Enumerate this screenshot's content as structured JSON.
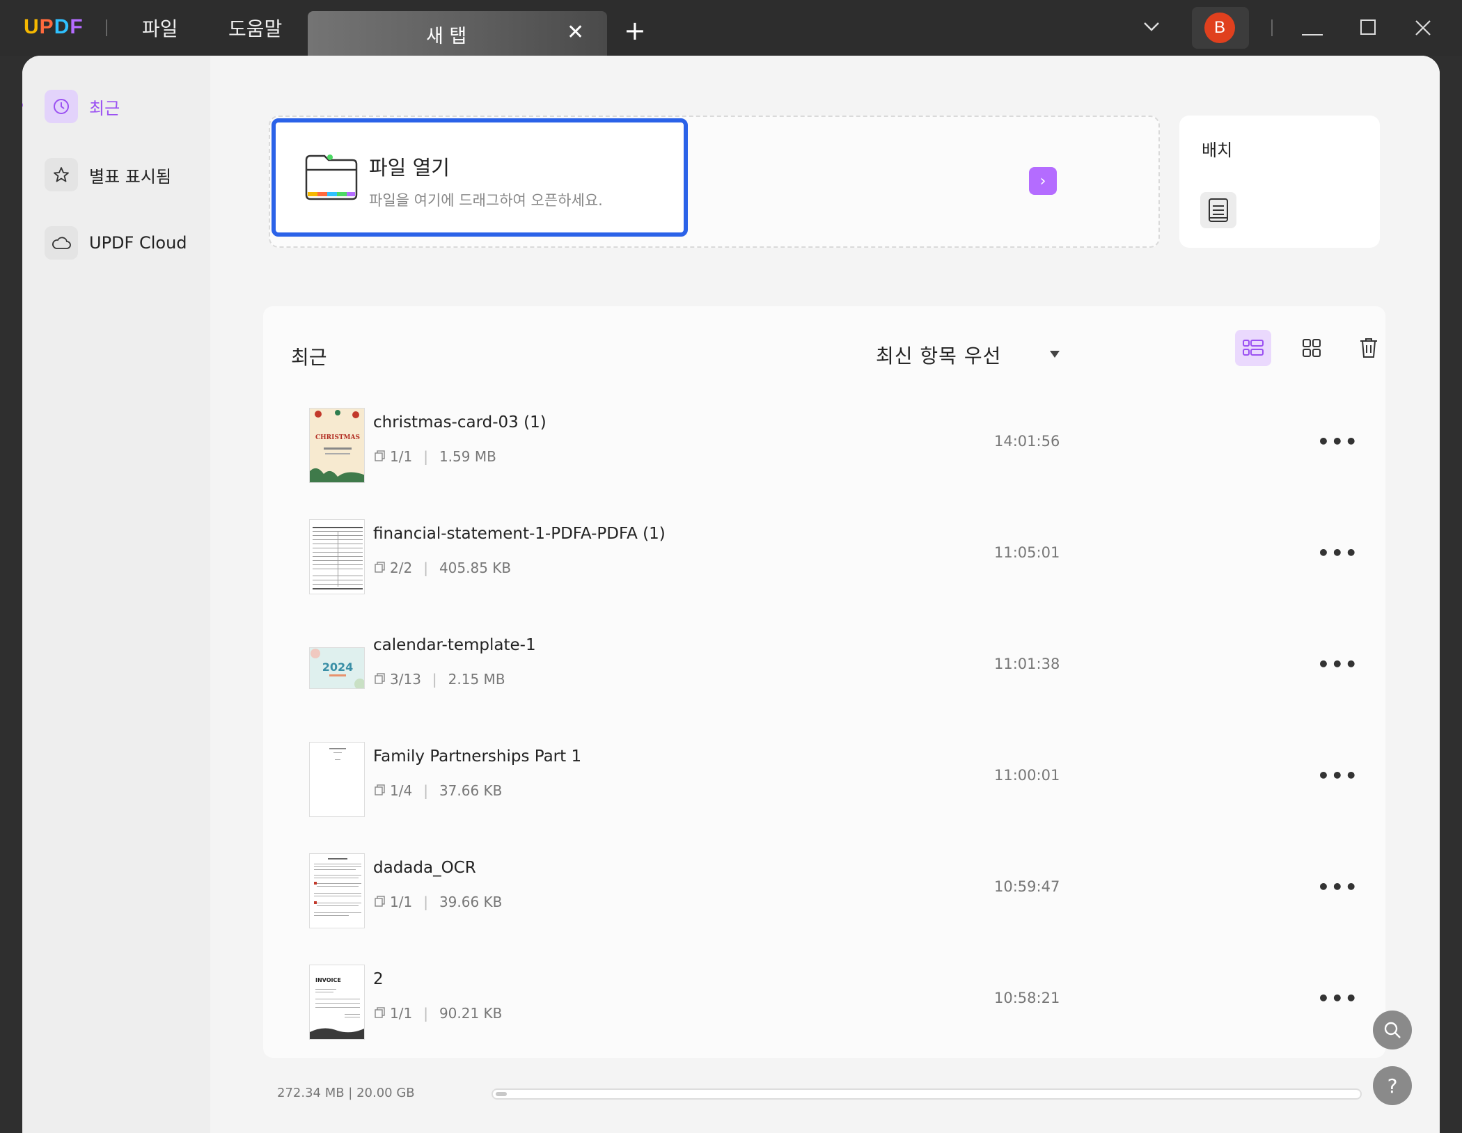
{
  "titlebar": {
    "logo_letters": [
      "U",
      "P",
      "D",
      "F"
    ],
    "menu": [
      "파일",
      "도움말"
    ],
    "tab_label": "새 탭",
    "tab_close": "✕",
    "new_tab": "+",
    "avatar_initial": "B"
  },
  "sidebar": {
    "items": [
      {
        "label": "최근",
        "icon": "clock-icon",
        "active": true
      },
      {
        "label": "별표 표시됨",
        "icon": "star-icon",
        "active": false
      },
      {
        "label": "UPDF Cloud",
        "icon": "cloud-icon",
        "active": false
      }
    ]
  },
  "open_file": {
    "title": "파일 열기",
    "subtitle": "파일을 여기에 드래그하여 오픈하세요.",
    "arrow": "›"
  },
  "batch": {
    "label": "배치"
  },
  "recent": {
    "title": "최근",
    "sort_label": "최신 항목 우선",
    "files": [
      {
        "name": "christmas-card-03 (1)",
        "pages": "1/1",
        "size": "1.59 MB",
        "time": "14:01:56"
      },
      {
        "name": "financial-statement-1-PDFA-PDFA (1)",
        "pages": "2/2",
        "size": "405.85 KB",
        "time": "11:05:01"
      },
      {
        "name": "calendar-template-1",
        "pages": "3/13",
        "size": "2.15 MB",
        "time": "11:01:38"
      },
      {
        "name": "Family Partnerships Part 1",
        "pages": "1/4",
        "size": "37.66 KB",
        "time": "11:00:01"
      },
      {
        "name": "dadada_OCR",
        "pages": "1/1",
        "size": "39.66 KB",
        "time": "10:59:47"
      },
      {
        "name": "2",
        "pages": "1/1",
        "size": "90.21 KB",
        "time": "10:58:21"
      }
    ],
    "more_label": "•••",
    "meta_sep": "|"
  },
  "storage": {
    "text": "272.34 MB | 20.00 GB",
    "used_fraction": 0.0133
  },
  "colors": {
    "accent": "#b46cff",
    "open_border": "#2b62e8"
  },
  "thumbs": {
    "calendar_year": "2024",
    "invoice_label": "INVOICE",
    "christmas_label": "CHRISTMAS"
  },
  "fab": {
    "help": "?"
  }
}
